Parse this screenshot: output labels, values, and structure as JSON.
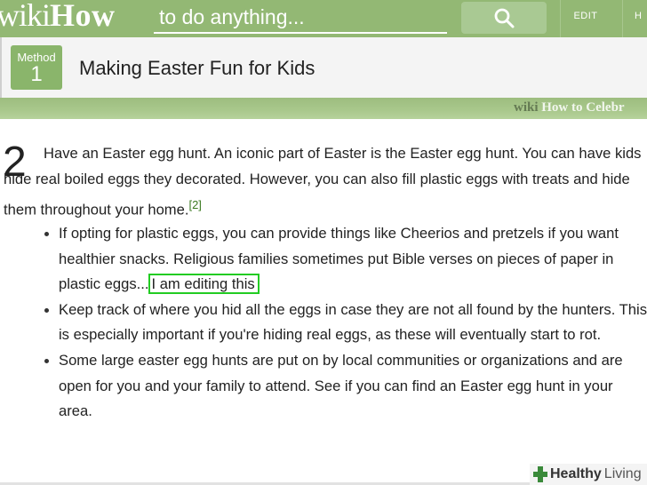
{
  "header": {
    "logo_wiki": "wiki",
    "logo_how": "How",
    "search_placeholder": "to do anything...",
    "edit_label": "EDIT",
    "help_label": "H"
  },
  "method": {
    "badge_label": "Method",
    "badge_number": "1",
    "title": "Making Easter Fun for Kids"
  },
  "image_strip": {
    "watermark_wiki": "wiki",
    "watermark_rest": "How to Celebr"
  },
  "step": {
    "number": "2",
    "text": "Have an Easter egg hunt. An iconic part of Easter is the Easter egg hunt. You can have kids hide real boiled eggs they decorated. However, you can also fill plastic eggs with treats and hide them throughout your home.",
    "citation": "[2]",
    "bullets": [
      {
        "text": "If opting for plastic eggs, you can provide things like Cheerios and pretzels if you want healthier snacks. Religious families sometimes put Bible verses on pieces of paper in plastic eggs...",
        "highlight": "I am editing this"
      },
      {
        "text": "Keep track of where you hid all the eggs in case they are not all found by the hunters. This is especially important if you're hiding real eggs, as these will eventually start to rot."
      },
      {
        "text": "Some large easter egg hunts are put on by local communities or organizations and are open for you and your family to attend. See if you can find an Easter egg hunt in your area."
      }
    ]
  },
  "badge": {
    "healthy": "Healthy",
    "living": "Living"
  },
  "colors": {
    "header_green": "#93b874",
    "badge_green": "#8ab56b",
    "highlight_green": "#22cc22"
  }
}
